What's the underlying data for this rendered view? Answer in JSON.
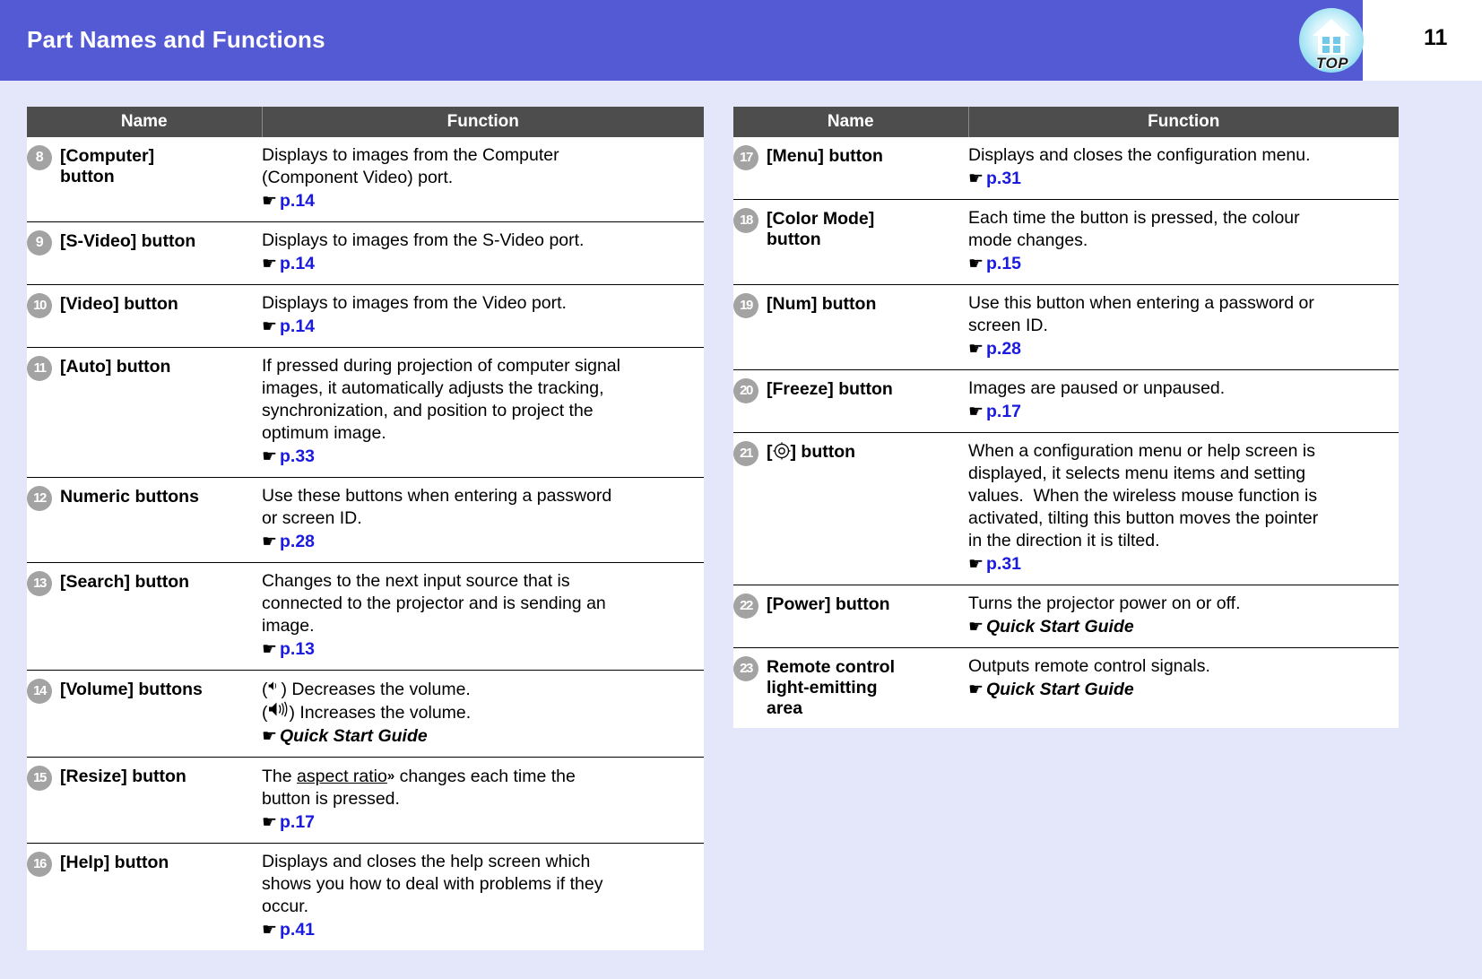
{
  "header": {
    "title": "Part Names and Functions",
    "page_number": "11",
    "top_icon_label": "TOP",
    "top_icon_name": "home-top-icon",
    "band_color": "#5459d4",
    "page_bg_color": "#e3e7f9"
  },
  "tables": [
    {
      "id": "left",
      "columns": {
        "name": "Name",
        "function": "Function"
      },
      "rows": [
        {
          "badge": "8",
          "name": [
            "[Computer]",
            "button"
          ],
          "function_lines": [
            "Displays to images from the Computer",
            "(Component Video) port."
          ],
          "ref": {
            "type": "page",
            "text": "p.14"
          }
        },
        {
          "badge": "9",
          "name": [
            "[S-Video] button"
          ],
          "function_lines": [
            "Displays to images from the S-Video port."
          ],
          "ref": {
            "type": "page",
            "text": "p.14"
          }
        },
        {
          "badge": "10",
          "name": [
            "[Video] button"
          ],
          "function_lines": [
            "Displays to images from the Video port."
          ],
          "ref": {
            "type": "page",
            "text": "p.14"
          }
        },
        {
          "badge": "11",
          "name": [
            "[Auto] button"
          ],
          "function_lines": [
            "If pressed during projection of computer signal",
            "images, it automatically adjusts the tracking,",
            "synchronization, and position to project the",
            "optimum image."
          ],
          "ref": {
            "type": "page",
            "text": "p.33"
          }
        },
        {
          "badge": "12",
          "name": [
            "Numeric buttons"
          ],
          "function_lines": [
            "Use these buttons when entering a password",
            "or screen ID."
          ],
          "ref": {
            "type": "page",
            "text": "p.28"
          }
        },
        {
          "badge": "13",
          "name": [
            "[Search] button"
          ],
          "function_lines": [
            "Changes to the next input source that is",
            "connected to the projector and is sending an",
            "image."
          ],
          "ref": {
            "type": "page",
            "text": "p.13"
          }
        },
        {
          "badge": "14",
          "name": [
            "[Volume] buttons"
          ],
          "function_lines": [
            "(↶) Decreases the volume.",
            "(↶) Increases the volume."
          ],
          "function_special": "volume",
          "volume_down_label": "Decreases the volume.",
          "volume_up_label": "Increases the volume.",
          "ref": {
            "type": "guide",
            "text": "Quick Start Guide"
          }
        },
        {
          "badge": "15",
          "name": [
            "[Resize] button"
          ],
          "function_special": "resize",
          "resize_prefix": "The ",
          "resize_term": "aspect ratio",
          "resize_mark": "»",
          "resize_suffix": " changes each time the",
          "resize_line2": "button is pressed.",
          "function_lines": [
            "The aspect ratio» changes each time the",
            "button is pressed."
          ],
          "ref": {
            "type": "page",
            "text": "p.17"
          }
        },
        {
          "badge": "16",
          "name": [
            "[Help] button"
          ],
          "function_lines": [
            "Displays and closes the help screen which",
            "shows you how to deal with problems if they",
            "occur."
          ],
          "ref": {
            "type": "page",
            "text": "p.41"
          }
        }
      ]
    },
    {
      "id": "right",
      "columns": {
        "name": "Name",
        "function": "Function"
      },
      "rows": [
        {
          "badge": "17",
          "name": [
            "[Menu] button"
          ],
          "function_lines": [
            "Displays and closes the configuration menu."
          ],
          "ref": {
            "type": "page",
            "text": "p.31"
          }
        },
        {
          "badge": "18",
          "name": [
            "[Color Mode]",
            "button"
          ],
          "function_lines": [
            "Each time the button is pressed, the colour",
            "mode changes."
          ],
          "ref": {
            "type": "page",
            "text": "p.15"
          }
        },
        {
          "badge": "19",
          "name": [
            "[Num] button"
          ],
          "function_lines": [
            "Use this button when entering a password or",
            "screen ID."
          ],
          "ref": {
            "type": "page",
            "text": "p.28"
          }
        },
        {
          "badge": "20",
          "name": [
            "[Freeze] button"
          ],
          "function_lines": [
            "Images are paused or unpaused."
          ],
          "ref": {
            "type": "page",
            "text": "p.17"
          }
        },
        {
          "badge": "21",
          "name": [
            "[◎] button"
          ],
          "name_icon": "directional-pad-icon",
          "function_lines": [
            "When a configuration menu or help screen is",
            "displayed, it selects menu items and setting",
            "values.  When the wireless mouse function is",
            "activated, tilting this button moves the pointer",
            "in the direction it is tilted."
          ],
          "ref": {
            "type": "page",
            "text": "p.31"
          }
        },
        {
          "badge": "22",
          "name": [
            "[Power] button"
          ],
          "function_lines": [
            "Turns the projector power on or off."
          ],
          "ref": {
            "type": "guide",
            "text": "Quick Start Guide"
          }
        },
        {
          "badge": "23",
          "name": [
            "Remote control",
            "light-emitting",
            "area"
          ],
          "function_lines": [
            "Outputs remote control signals."
          ],
          "ref": {
            "type": "guide",
            "text": "Quick Start Guide"
          }
        }
      ]
    }
  ]
}
